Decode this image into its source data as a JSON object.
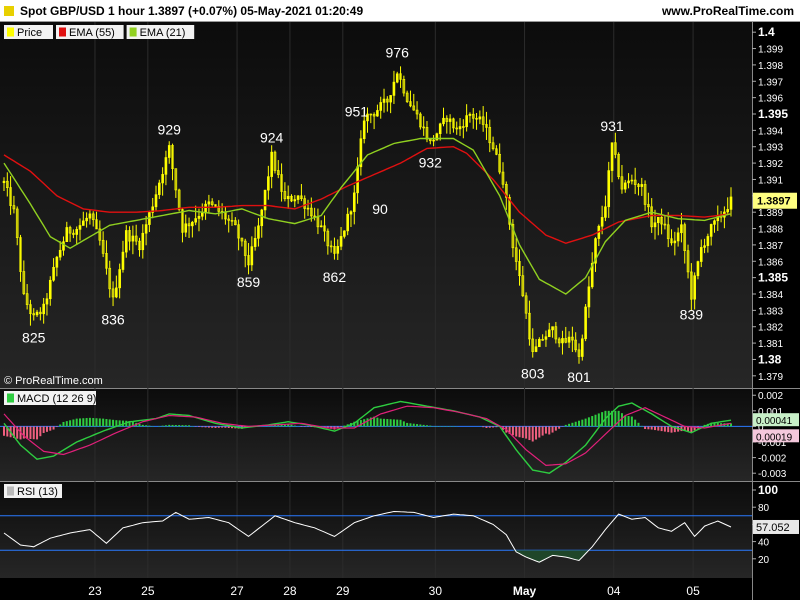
{
  "header": {
    "title": "Spot GBP/USD 1 hour 1.3897 (+0.07%) 05-May-2021 01:20:49",
    "site": "www.ProRealTime.com"
  },
  "colors": {
    "candle": "#ffff00",
    "ema55": "#e01010",
    "ema21": "#90d020",
    "macd_line": "#2ecc40",
    "signal_line": "#e0207a",
    "hist_pos": "#2ecc40",
    "hist_neg": "#f06080",
    "rsi": "#ffffff",
    "rsi_band": "#2a7aff",
    "price_tag": "#ffff80"
  },
  "price_panel": {
    "legend": [
      {
        "label": "Price",
        "color": "#ffff00"
      },
      {
        "label": "EMA (55)",
        "color": "#e01010"
      },
      {
        "label": "EMA (21)",
        "color": "#90d020"
      }
    ],
    "watermark": "© ProRealTime.com",
    "last_price_label": "1.3897"
  },
  "macd_panel": {
    "legend": "MACD (12 26 9)",
    "ticks": [
      "0.002",
      "0.001",
      "0",
      "-0.001",
      "-0.002",
      "-0.003"
    ],
    "macd_value_label": "0.00041",
    "signal_value_label": "0.00019"
  },
  "rsi_panel": {
    "legend": "RSI (13)",
    "ticks": [
      "100",
      "80",
      "60",
      "40",
      "20"
    ],
    "value_label": "57.052"
  },
  "chart_data": {
    "type": "line",
    "title": "Spot GBP/USD 1 hour 1.3897 (+0.07%) 05-May-2021 01:20:49",
    "x_ticks": [
      "23",
      "25",
      "27",
      "28",
      "29",
      "30",
      "May",
      "04",
      "05"
    ],
    "price_axis": {
      "ticks": [
        "1.4",
        "1.399",
        "1.398",
        "1.397",
        "1.396",
        "1.395",
        "1.394",
        "1.393",
        "1.392",
        "1.391",
        "1.39",
        "1.389",
        "1.388",
        "1.387",
        "1.386",
        "1.385",
        "1.384",
        "1.383",
        "1.382",
        "1.381",
        "1.38",
        "1.379"
      ],
      "bold_ticks": [
        "1.4",
        "1.395",
        "1.385",
        "1.38"
      ],
      "ylim": [
        1.3785,
        1.4005
      ]
    },
    "ema55_anchors": [
      [
        0,
        1.3925
      ],
      [
        8,
        1.3915
      ],
      [
        16,
        1.39
      ],
      [
        24,
        1.3892
      ],
      [
        32,
        1.389
      ],
      [
        40,
        1.389
      ],
      [
        48,
        1.3891
      ],
      [
        56,
        1.3893
      ],
      [
        64,
        1.3893
      ],
      [
        72,
        1.3894
      ],
      [
        80,
        1.3894
      ],
      [
        88,
        1.3892
      ],
      [
        96,
        1.3898
      ],
      [
        104,
        1.3906
      ],
      [
        112,
        1.3913
      ],
      [
        120,
        1.392
      ],
      [
        128,
        1.3929
      ],
      [
        136,
        1.393
      ],
      [
        140,
        1.3926
      ],
      [
        148,
        1.391
      ],
      [
        156,
        1.389
      ],
      [
        164,
        1.3876
      ],
      [
        170,
        1.3871
      ],
      [
        178,
        1.3876
      ],
      [
        186,
        1.3884
      ],
      [
        196,
        1.3888
      ],
      [
        204,
        1.3888
      ],
      [
        212,
        1.3887
      ],
      [
        220,
        1.3889
      ]
    ],
    "ema21_anchors": [
      [
        0,
        1.392
      ],
      [
        8,
        1.3895
      ],
      [
        14,
        1.3875
      ],
      [
        20,
        1.3868
      ],
      [
        26,
        1.3875
      ],
      [
        32,
        1.3882
      ],
      [
        40,
        1.3885
      ],
      [
        48,
        1.3888
      ],
      [
        56,
        1.3891
      ],
      [
        64,
        1.3889
      ],
      [
        72,
        1.3892
      ],
      [
        80,
        1.3886
      ],
      [
        88,
        1.3883
      ],
      [
        96,
        1.3888
      ],
      [
        102,
        1.3905
      ],
      [
        110,
        1.3925
      ],
      [
        118,
        1.3932
      ],
      [
        126,
        1.3935
      ],
      [
        136,
        1.3935
      ],
      [
        142,
        1.3928
      ],
      [
        150,
        1.39
      ],
      [
        156,
        1.387
      ],
      [
        162,
        1.3849
      ],
      [
        170,
        1.384
      ],
      [
        176,
        1.385
      ],
      [
        182,
        1.3872
      ],
      [
        188,
        1.3885
      ],
      [
        196,
        1.389
      ],
      [
        204,
        1.3886
      ],
      [
        212,
        1.3885
      ],
      [
        220,
        1.3889
      ]
    ],
    "price_anchors": [
      [
        0,
        1.3908
      ],
      [
        3,
        1.389
      ],
      [
        6,
        1.3838
      ],
      [
        9,
        1.3825
      ],
      [
        12,
        1.3831
      ],
      [
        16,
        1.3862
      ],
      [
        19,
        1.3878
      ],
      [
        22,
        1.388
      ],
      [
        26,
        1.3888
      ],
      [
        29,
        1.3872
      ],
      [
        33,
        1.3836
      ],
      [
        37,
        1.3877
      ],
      [
        41,
        1.387
      ],
      [
        45,
        1.3895
      ],
      [
        50,
        1.3929
      ],
      [
        54,
        1.388
      ],
      [
        57,
        1.3885
      ],
      [
        62,
        1.3895
      ],
      [
        66,
        1.3889
      ],
      [
        70,
        1.388
      ],
      [
        74,
        1.3859
      ],
      [
        77,
        1.388
      ],
      [
        81,
        1.3924
      ],
      [
        85,
        1.3897
      ],
      [
        89,
        1.39
      ],
      [
        93,
        1.389
      ],
      [
        96,
        1.388
      ],
      [
        100,
        1.3862
      ],
      [
        103,
        1.388
      ],
      [
        106,
        1.39
      ],
      [
        109,
        1.3948
      ],
      [
        112,
        1.3951
      ],
      [
        116,
        1.3958
      ],
      [
        119,
        1.3976
      ],
      [
        122,
        1.396
      ],
      [
        126,
        1.3945
      ],
      [
        129,
        1.3932
      ],
      [
        134,
        1.3948
      ],
      [
        137,
        1.394
      ],
      [
        141,
        1.395
      ],
      [
        145,
        1.3944
      ],
      [
        148,
        1.393
      ],
      [
        151,
        1.391
      ],
      [
        154,
        1.387
      ],
      [
        157,
        1.384
      ],
      [
        160,
        1.3803
      ],
      [
        163,
        1.3813
      ],
      [
        166,
        1.3818
      ],
      [
        169,
        1.381
      ],
      [
        172,
        1.3813
      ],
      [
        174,
        1.3801
      ],
      [
        176,
        1.383
      ],
      [
        179,
        1.3872
      ],
      [
        182,
        1.3895
      ],
      [
        184,
        1.3931
      ],
      [
        187,
        1.3905
      ],
      [
        190,
        1.391
      ],
      [
        193,
        1.3905
      ],
      [
        196,
        1.3883
      ],
      [
        199,
        1.3885
      ],
      [
        202,
        1.387
      ],
      [
        205,
        1.388
      ],
      [
        208,
        1.3839
      ],
      [
        211,
        1.3868
      ],
      [
        214,
        1.388
      ],
      [
        217,
        1.3888
      ],
      [
        220,
        1.3897
      ]
    ],
    "annotations": [
      {
        "label": "825",
        "x": 9,
        "y": 1.3825,
        "position": "below"
      },
      {
        "label": "836",
        "x": 33,
        "y": 1.3836,
        "position": "below"
      },
      {
        "label": "929",
        "x": 50,
        "y": 1.3929,
        "position": "above"
      },
      {
        "label": "859",
        "x": 74,
        "y": 1.3859,
        "position": "below"
      },
      {
        "label": "924",
        "x": 81,
        "y": 1.3924,
        "position": "above"
      },
      {
        "label": "862",
        "x": 100,
        "y": 1.3862,
        "position": "below"
      },
      {
        "label": "90",
        "x": 109,
        "y": 1.39,
        "position": "right"
      },
      {
        "label": "951",
        "x": 112,
        "y": 1.3951,
        "position": "left"
      },
      {
        "label": "976",
        "x": 119,
        "y": 1.3976,
        "position": "above"
      },
      {
        "label": "932",
        "x": 129,
        "y": 1.3932,
        "position": "below"
      },
      {
        "label": "803",
        "x": 160,
        "y": 1.3803,
        "position": "below"
      },
      {
        "label": "801",
        "x": 174,
        "y": 1.3801,
        "position": "below"
      },
      {
        "label": "931",
        "x": 184,
        "y": 1.3931,
        "position": "above"
      },
      {
        "label": "839",
        "x": 208,
        "y": 1.3839,
        "position": "below"
      }
    ],
    "macd": {
      "ylim": [
        -0.0035,
        0.0024
      ],
      "macd_anchors": [
        [
          0,
          0.0002
        ],
        [
          5,
          -0.0012
        ],
        [
          10,
          -0.0021
        ],
        [
          15,
          -0.0019
        ],
        [
          22,
          -0.001
        ],
        [
          30,
          -0.0003
        ],
        [
          38,
          0.0003
        ],
        [
          46,
          0.0005
        ],
        [
          50,
          0.0008
        ],
        [
          56,
          0.0007
        ],
        [
          64,
          0.0002
        ],
        [
          72,
          -0.0001
        ],
        [
          80,
          0.0001
        ],
        [
          86,
          0.0003
        ],
        [
          92,
          0.0001
        ],
        [
          100,
          -0.0003
        ],
        [
          106,
          0.0002
        ],
        [
          112,
          0.0012
        ],
        [
          120,
          0.0016
        ],
        [
          128,
          0.0013
        ],
        [
          136,
          0.001
        ],
        [
          144,
          0.0006
        ],
        [
          150,
          0.0
        ],
        [
          155,
          -0.0015
        ],
        [
          160,
          -0.0028
        ],
        [
          165,
          -0.003
        ],
        [
          170,
          -0.0023
        ],
        [
          176,
          -0.0012
        ],
        [
          182,
          0.0005
        ],
        [
          186,
          0.0013
        ],
        [
          190,
          0.0015
        ],
        [
          196,
          0.0008
        ],
        [
          202,
          0.0
        ],
        [
          208,
          -0.0004
        ],
        [
          214,
          0.0002
        ],
        [
          220,
          0.0004
        ]
      ],
      "signal_anchors": [
        [
          0,
          0.0008
        ],
        [
          6,
          -0.0006
        ],
        [
          12,
          -0.0016
        ],
        [
          18,
          -0.0018
        ],
        [
          26,
          -0.0012
        ],
        [
          34,
          -0.0004
        ],
        [
          42,
          0.0003
        ],
        [
          50,
          0.0007
        ],
        [
          58,
          0.0006
        ],
        [
          66,
          0.0002
        ],
        [
          74,
          0.0
        ],
        [
          82,
          0.0001
        ],
        [
          90,
          0.0002
        ],
        [
          98,
          -0.0001
        ],
        [
          106,
          -0.0001
        ],
        [
          114,
          0.0008
        ],
        [
          122,
          0.0013
        ],
        [
          130,
          0.0012
        ],
        [
          138,
          0.0009
        ],
        [
          146,
          0.0005
        ],
        [
          152,
          -0.0002
        ],
        [
          158,
          -0.0015
        ],
        [
          164,
          -0.0025
        ],
        [
          170,
          -0.0024
        ],
        [
          176,
          -0.0017
        ],
        [
          182,
          -0.0005
        ],
        [
          188,
          0.0007
        ],
        [
          194,
          0.0012
        ],
        [
          200,
          0.0006
        ],
        [
          206,
          0.0
        ],
        [
          212,
          -0.0001
        ],
        [
          220,
          0.0002
        ]
      ]
    },
    "rsi": {
      "ylim": [
        0,
        100
      ],
      "bands": [
        70,
        30
      ],
      "anchors": [
        [
          0,
          50
        ],
        [
          5,
          36
        ],
        [
          9,
          34
        ],
        [
          14,
          44
        ],
        [
          20,
          50
        ],
        [
          26,
          54
        ],
        [
          31,
          38
        ],
        [
          36,
          56
        ],
        [
          42,
          62
        ],
        [
          48,
          64
        ],
        [
          52,
          74
        ],
        [
          56,
          66
        ],
        [
          62,
          68
        ],
        [
          68,
          62
        ],
        [
          74,
          46
        ],
        [
          78,
          58
        ],
        [
          82,
          70
        ],
        [
          88,
          62
        ],
        [
          94,
          56
        ],
        [
          100,
          46
        ],
        [
          106,
          62
        ],
        [
          112,
          70
        ],
        [
          118,
          75
        ],
        [
          124,
          74
        ],
        [
          130,
          68
        ],
        [
          136,
          72
        ],
        [
          142,
          70
        ],
        [
          148,
          60
        ],
        [
          152,
          48
        ],
        [
          155,
          28
        ],
        [
          158,
          22
        ],
        [
          162,
          16
        ],
        [
          166,
          24
        ],
        [
          170,
          22
        ],
        [
          174,
          18
        ],
        [
          178,
          34
        ],
        [
          182,
          54
        ],
        [
          186,
          72
        ],
        [
          190,
          66
        ],
        [
          194,
          68
        ],
        [
          198,
          56
        ],
        [
          202,
          52
        ],
        [
          206,
          62
        ],
        [
          209,
          46
        ],
        [
          212,
          58
        ],
        [
          216,
          64
        ],
        [
          220,
          57
        ]
      ]
    }
  }
}
